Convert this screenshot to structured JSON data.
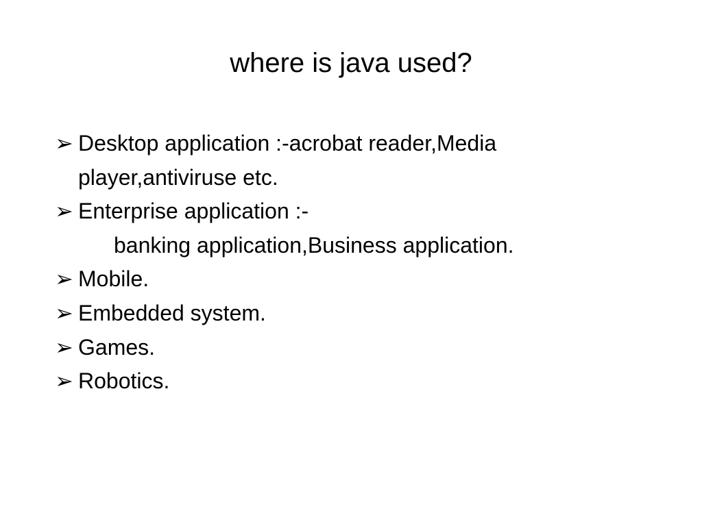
{
  "title": "where  is  java used?",
  "marker": "➢",
  "items": {
    "i1": "Desktop application :-acrobat reader,Media player,antiviruse etc.",
    "i2": "Enterprise application :-",
    "i2sub": "banking application,Business application.",
    "i3": " Mobile.",
    "i4": "Embedded system.",
    "i5": "Games.",
    "i6": "Robotics."
  }
}
